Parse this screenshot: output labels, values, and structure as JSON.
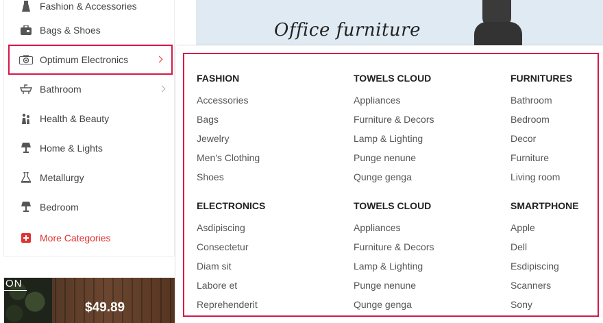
{
  "sidebar": {
    "items": [
      {
        "label": "Fashion & Accessories",
        "icon": "dress-icon"
      },
      {
        "label": "Bags & Shoes",
        "icon": "bag-icon"
      },
      {
        "label": "Optimum Electronics",
        "icon": "camera-icon",
        "has_submenu": true,
        "active": true
      },
      {
        "label": "Bathroom",
        "icon": "sink-icon",
        "has_submenu": true
      },
      {
        "label": "Health & Beauty",
        "icon": "people-icon"
      },
      {
        "label": "Home & Lights",
        "icon": "lamp-icon"
      },
      {
        "label": "Metallurgy",
        "icon": "flask-icon"
      },
      {
        "label": "Bedroom",
        "icon": "lamp-icon"
      }
    ],
    "more_label": "More Categories"
  },
  "banner": {
    "title": "Office furniture"
  },
  "promo": {
    "tag": "ON",
    "price": "$49.89"
  },
  "mega_menu": {
    "columns": [
      {
        "heading": "FASHION",
        "items": [
          "Accessories",
          "Bags",
          "Jewelry",
          "Men's Clothing",
          "Shoes"
        ]
      },
      {
        "heading": "TOWELS CLOUD",
        "items": [
          "Appliances",
          "Furniture & Decors",
          "Lamp & Lighting",
          "Punge nenune",
          "Qunge genga"
        ]
      },
      {
        "heading": "FURNITURES",
        "items": [
          "Bathroom",
          "Bedroom",
          "Decor",
          "Furniture",
          "Living room"
        ]
      },
      {
        "heading": "ELECTRONICS",
        "items": [
          "Asdipiscing",
          "Consectetur",
          "Diam sit",
          "Labore et",
          "Reprehenderit"
        ]
      },
      {
        "heading": "TOWELS CLOUD",
        "items": [
          "Appliances",
          "Furniture & Decors",
          "Lamp & Lighting",
          "Punge nenune",
          "Qunge genga"
        ]
      },
      {
        "heading": "SMARTPHONE",
        "items": [
          "Apple",
          "Dell",
          "Esdipiscing",
          "Scanners",
          "Sony"
        ]
      }
    ]
  },
  "colors": {
    "accent": "#e0322f",
    "highlight_frame": "#d6184a"
  }
}
